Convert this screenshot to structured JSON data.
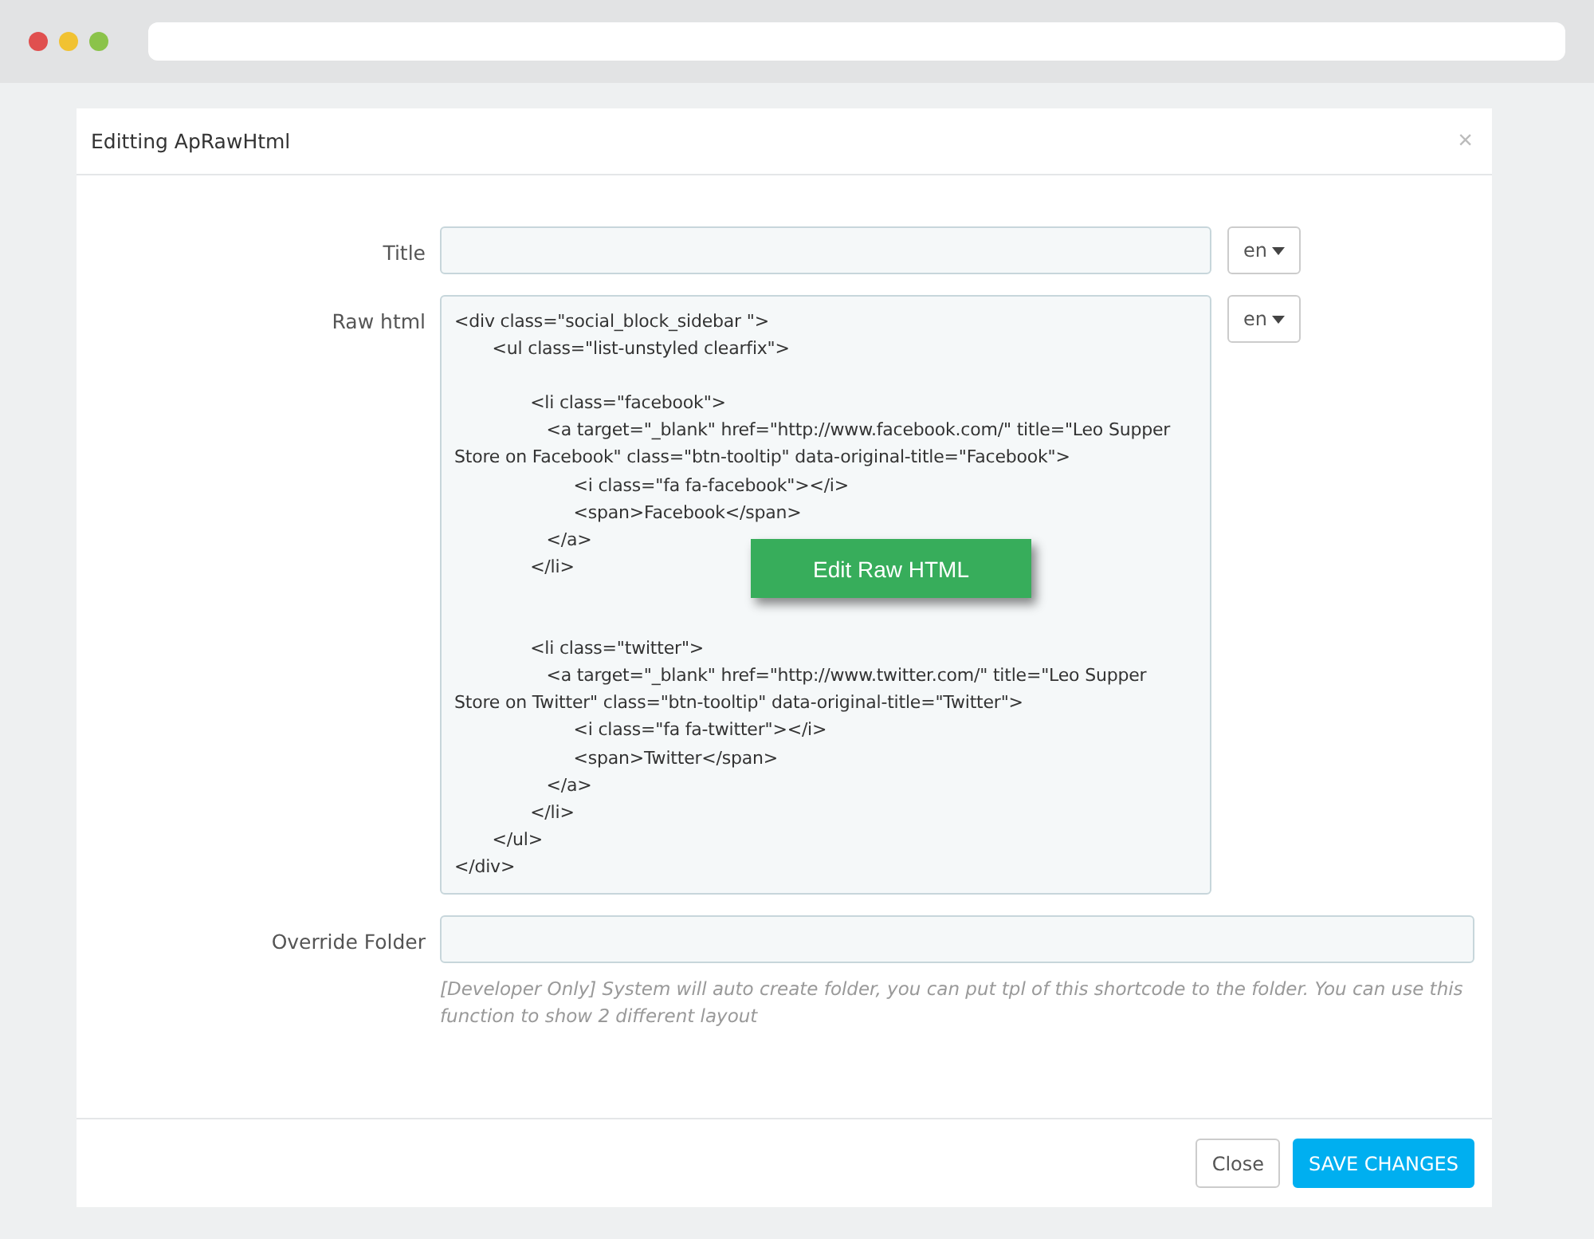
{
  "window": {
    "title": "Editting ApRawHtml",
    "close": "×"
  },
  "fields": [
    {
      "label": "Title",
      "language": "en"
    },
    {
      "label": "Raw html",
      "value": "<div class=\"social_block_sidebar \">\n       <ul class=\"list-unstyled clearfix\">\n\n              <li class=\"facebook\">\n                 <a target=\"_blank\" href=\"http://www.facebook.com/\" title=\"Leo Supper Store on Facebook\" class=\"btn-tooltip\" data-original-title=\"Facebook\">\n                      <i class=\"fa fa-facebook\"></i>\n                      <span>Facebook</span>\n                 </a>\n              </li>\n\n\n              <li class=\"twitter\">\n                 <a target=\"_blank\" href=\"http://www.twitter.com/\" title=\"Leo Supper Store on Twitter\" class=\"btn-tooltip\" data-original-title=\"Twitter\">\n                      <i class=\"fa fa-twitter\"></i>\n                      <span>Twitter</span>\n                 </a>\n              </li>\n       </ul>\n</div>",
      "language": "en"
    },
    {
      "label": "Override Folder",
      "help": "[Developer Only] System will auto create folder, you can put tpl of this shortcode to the folder. You can use this function to show 2 different layout"
    }
  ],
  "callout": "Edit Raw HTML",
  "buttons": [
    {
      "label": "Close",
      "kind": "default"
    },
    {
      "label": "SAVE CHANGES",
      "kind": "primary"
    }
  ]
}
